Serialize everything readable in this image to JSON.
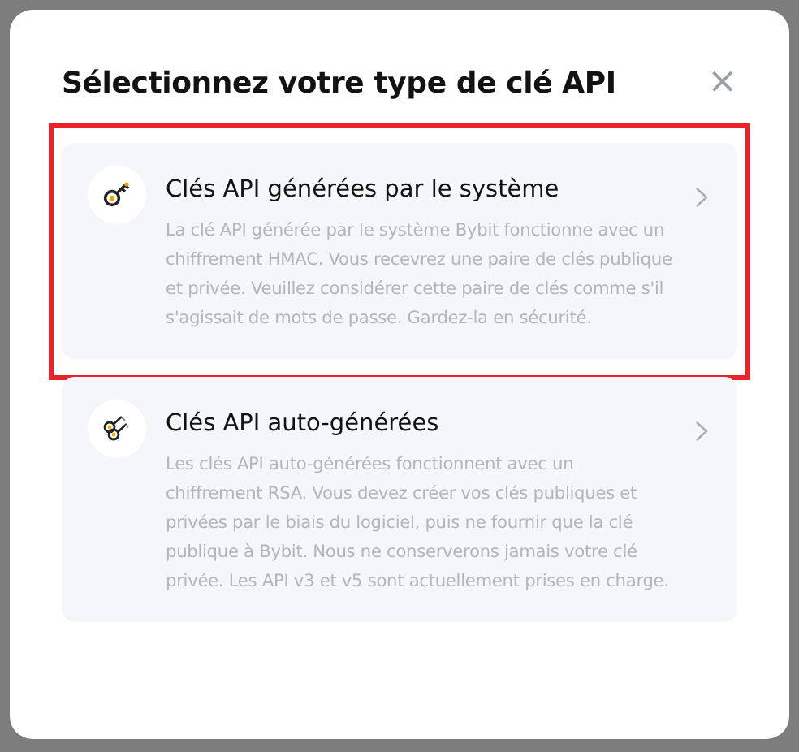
{
  "dialog": {
    "title": "Sélectionnez votre type de clé API",
    "close_label": "×"
  },
  "options": [
    {
      "kind": "single_key",
      "title": "Clés API générées par le système",
      "description": "La clé API générée par le système Bybit fonctionne avec un chiffrement HMAC. Vous recevrez une paire de clés publique et privée. Veuillez considérer cette paire de clés comme s'il s'agissait de mots de passe. Gardez-la en sécurité.",
      "highlighted": true
    },
    {
      "kind": "key_pair",
      "title": "Clés API auto-générées",
      "description": "Les clés API auto-générées fonctionnent avec un chiffrement RSA. Vous devez créer vos clés publiques et privées par le biais du logiciel, puis ne fournir que la clé publique à Bybit. Nous ne conserverons jamais votre clé privée. Les API v3 et v5 sont actuellement prises en charge.",
      "highlighted": false
    }
  ]
}
